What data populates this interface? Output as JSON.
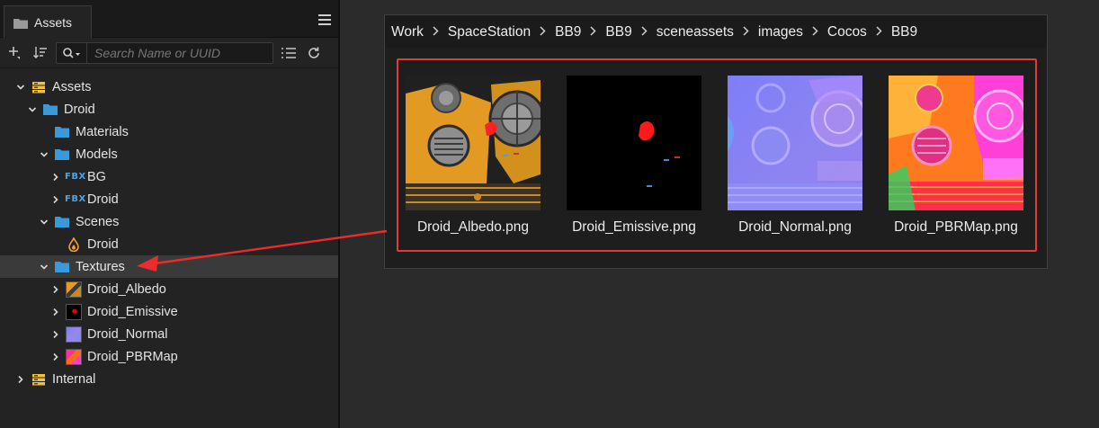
{
  "assets_panel": {
    "tab_title": "Assets",
    "search": {
      "placeholder": "Search Name or UUID",
      "value": ""
    },
    "tree": [
      {
        "label": "Assets",
        "kind": "db",
        "level": 0,
        "expanded": true
      },
      {
        "label": "Droid",
        "kind": "folder",
        "level": 1,
        "expanded": true
      },
      {
        "label": "Materials",
        "kind": "folder",
        "level": 2,
        "expanded": false,
        "leaf": true
      },
      {
        "label": "Models",
        "kind": "folder",
        "level": 2,
        "expanded": true
      },
      {
        "label": "BG",
        "kind": "fbx",
        "level": 3,
        "expanded": false
      },
      {
        "label": "Droid",
        "kind": "fbx",
        "level": 3,
        "expanded": false
      },
      {
        "label": "Scenes",
        "kind": "folder",
        "level": 2,
        "expanded": true
      },
      {
        "label": "Droid",
        "kind": "scene",
        "level": 3,
        "leaf": true
      },
      {
        "label": "Textures",
        "kind": "folder",
        "level": 2,
        "expanded": true,
        "selected": true
      },
      {
        "label": "Droid_Albedo",
        "kind": "texture-albedo",
        "level": 3,
        "expanded": false
      },
      {
        "label": "Droid_Emissive",
        "kind": "texture-emissive",
        "level": 3,
        "expanded": false
      },
      {
        "label": "Droid_Normal",
        "kind": "texture-normal",
        "level": 3,
        "expanded": false
      },
      {
        "label": "Droid_PBRMap",
        "kind": "texture-pbr",
        "level": 3,
        "expanded": false
      },
      {
        "label": "Internal",
        "kind": "db",
        "level": 0,
        "expanded": false
      }
    ]
  },
  "browser": {
    "breadcrumb": [
      "Work",
      "SpaceStation",
      "BB9",
      "BB9",
      "sceneassets",
      "images",
      "Cocos",
      "BB9"
    ],
    "files": [
      {
        "name": "Droid_Albedo.png",
        "kind": "albedo"
      },
      {
        "name": "Droid_Emissive.png",
        "kind": "emissive"
      },
      {
        "name": "Droid_Normal.png",
        "kind": "normal"
      },
      {
        "name": "Droid_PBRMap.png",
        "kind": "pbr"
      }
    ],
    "highlight_color": "#e53935"
  },
  "colors": {
    "folder": "#3a9ad9",
    "db": "#f0c040",
    "scene": "#f0a030",
    "arrow": "#ee2b2b"
  }
}
